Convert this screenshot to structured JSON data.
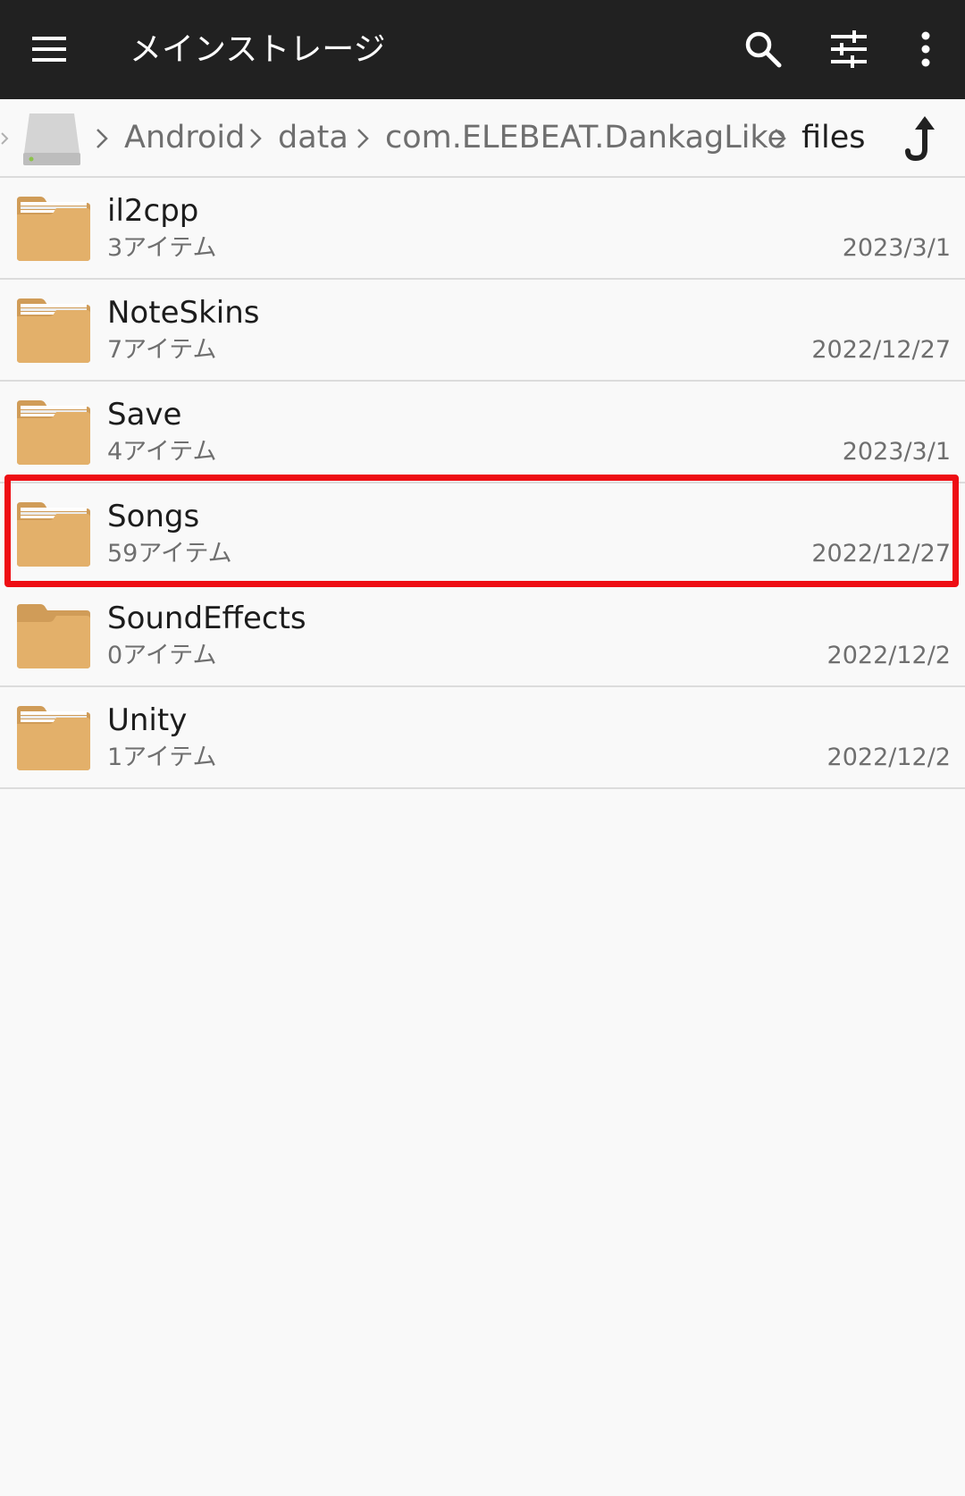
{
  "appbar": {
    "title": "メインストレージ",
    "icons": [
      "menu-icon",
      "search-icon",
      "tune-icon",
      "more-vert-icon"
    ]
  },
  "pathbar": {
    "drive_icon": "storage-drive-icon",
    "crumbs": [
      "Android",
      "data",
      "com.ELEBEAT.DankagLike",
      "files"
    ],
    "up_icon": "arrow-up-icon"
  },
  "files": [
    {
      "name": "il2cpp",
      "count": "3アイテム",
      "date": "2023/3/1"
    },
    {
      "name": "NoteSkins",
      "count": "7アイテム",
      "date": "2022/12/27"
    },
    {
      "name": "Save",
      "count": "4アイテム",
      "date": "2023/3/1"
    },
    {
      "name": "Songs",
      "count": "59アイテム",
      "date": "2022/12/27"
    },
    {
      "name": "SoundEffects",
      "count": "0アイテム",
      "date": "2022/12/2"
    },
    {
      "name": "Unity",
      "count": "1アイテム",
      "date": "2022/12/2"
    }
  ],
  "colors": {
    "appbar": "#212121",
    "folder": "#e3b06a",
    "highlight": "#ee0e14"
  }
}
